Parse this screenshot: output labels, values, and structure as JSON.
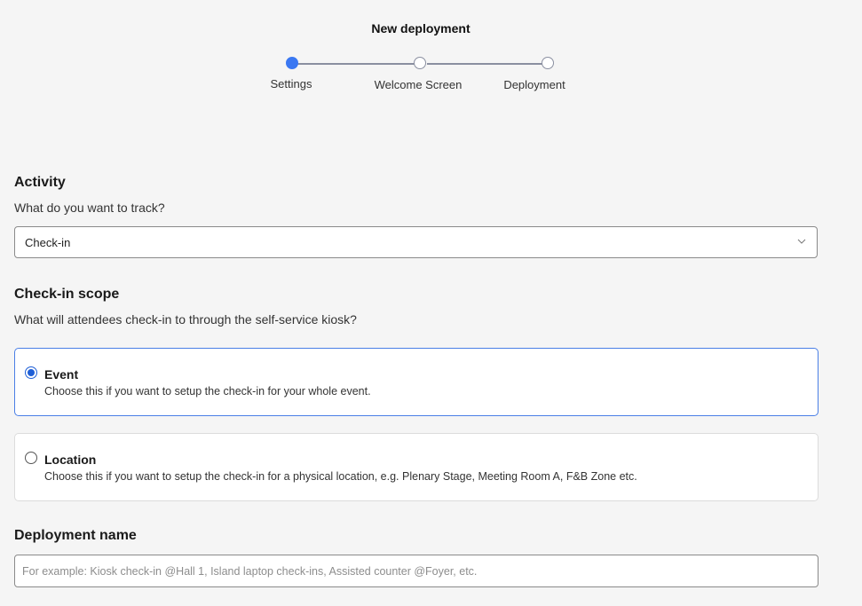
{
  "header": {
    "title": "New deployment"
  },
  "stepper": {
    "steps": [
      {
        "label": "Settings",
        "state": "active"
      },
      {
        "label": "Welcome Screen",
        "state": "pending"
      },
      {
        "label": "Deployment",
        "state": "pending"
      }
    ]
  },
  "activity": {
    "title": "Activity",
    "subtitle": "What do you want to track?",
    "selected_value": "Check-in",
    "icon": "chevron-down-icon"
  },
  "scope": {
    "title": "Check-in scope",
    "subtitle": "What will attendees check-in to through the self-service kiosk?",
    "options": [
      {
        "label": "Event",
        "description": "Choose this if you want to setup the check-in for your whole event.",
        "selected": true
      },
      {
        "label": "Location",
        "description": "Choose this if you want to setup the check-in for a physical location, e.g. Plenary Stage, Meeting Room A, F&B Zone etc.",
        "selected": false
      }
    ]
  },
  "deployment_name": {
    "title": "Deployment name",
    "value": "",
    "placeholder": "For example: Kiosk check-in @Hall 1, Island laptop check-ins, Assisted counter @Foyer, etc."
  },
  "colors": {
    "accent": "#3b78f2",
    "selected_border": "#4a7fe6",
    "background": "#f5f5f5"
  }
}
